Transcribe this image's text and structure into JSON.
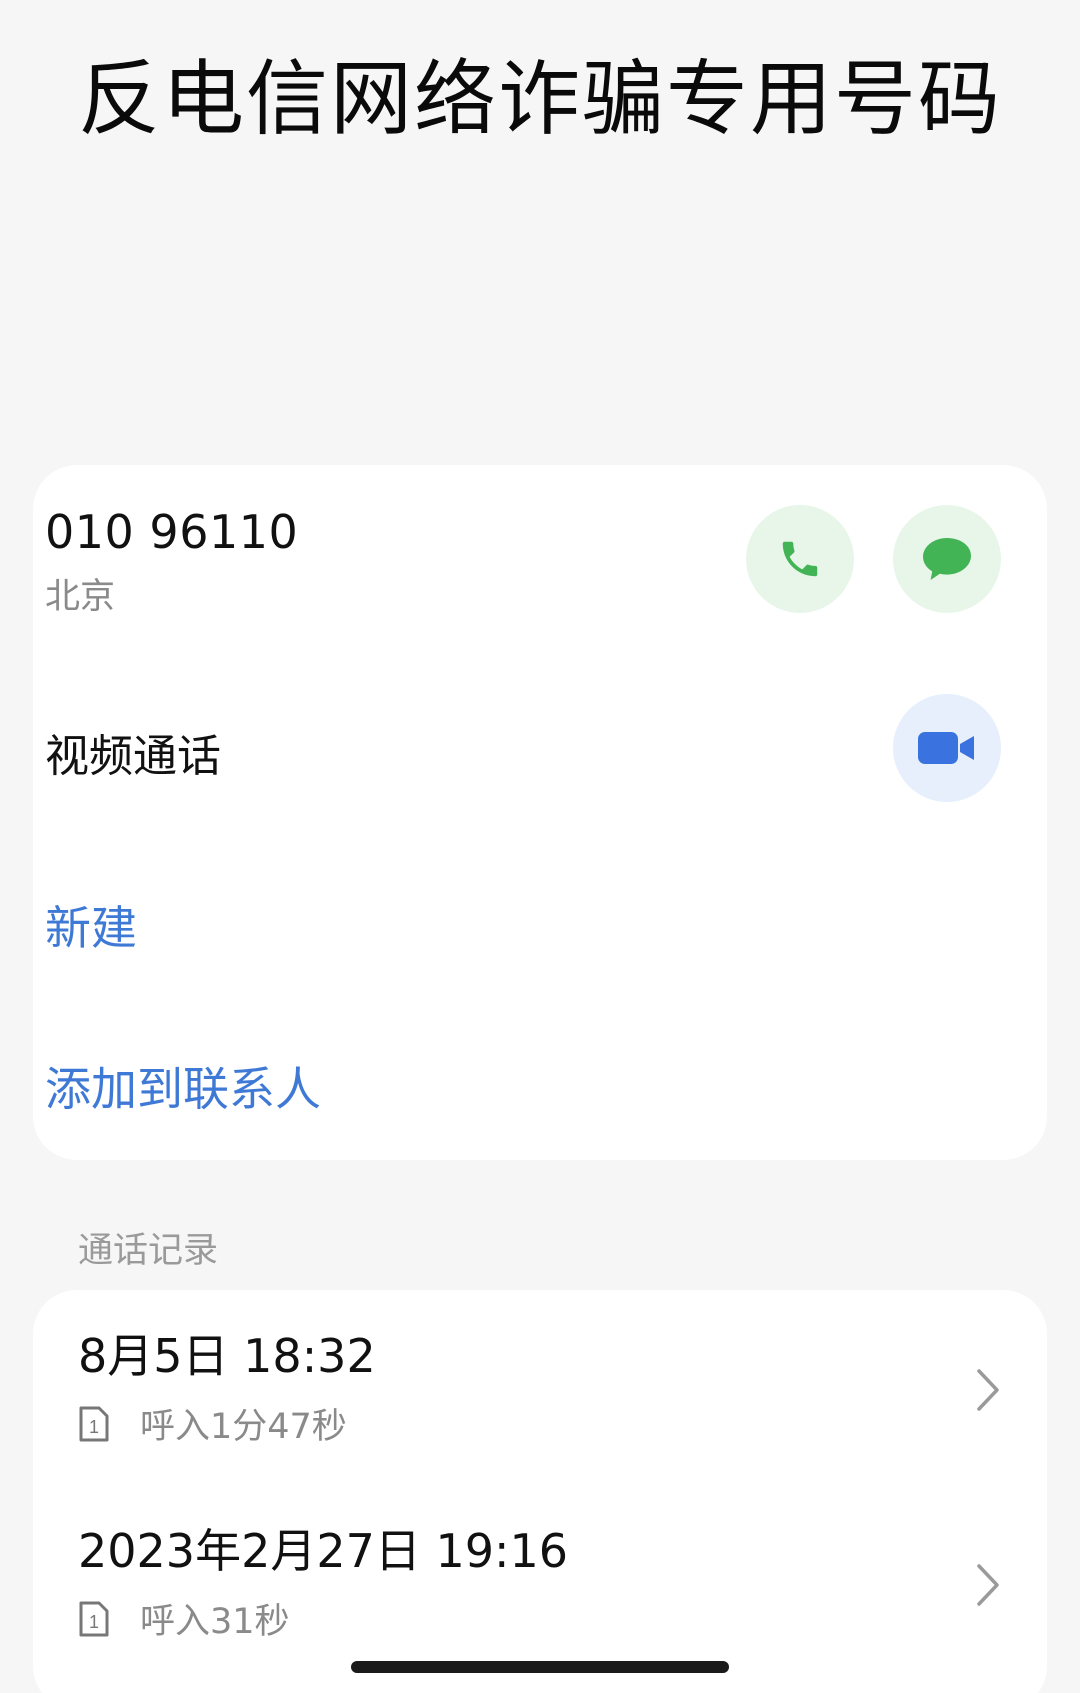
{
  "contact": {
    "title": "反电信网络诈骗专用号码",
    "number": "010 96110",
    "location": "北京"
  },
  "actions": {
    "call_icon": "phone-icon",
    "message_icon": "message-bubble-icon",
    "video_label": "视频通话",
    "video_icon": "video-camera-icon",
    "new_label": "新建",
    "add_contact_label": "添加到联系人"
  },
  "call_history": {
    "header": "通话记录",
    "entries": [
      {
        "date": "8月5日 18:32",
        "sim": "1",
        "detail": "呼入1分47秒"
      },
      {
        "date": "2023年2月27日 19:16",
        "sim": "1",
        "detail": "呼入31秒"
      }
    ]
  },
  "colors": {
    "accent_blue": "#3f79d6",
    "call_green": "#43b455",
    "video_blue": "#3a73e0",
    "background": "#f6f6f6"
  }
}
